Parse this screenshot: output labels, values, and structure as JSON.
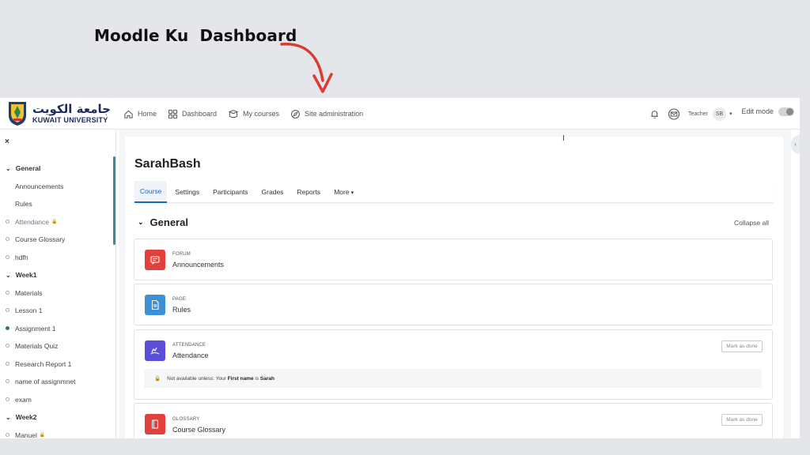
{
  "slide": {
    "title": "Moodle Ku  Dashboard",
    "arrow_color": "#d93a32"
  },
  "logo": {
    "arabic": "جامعة الكويت",
    "english": "KUWAIT UNIVERSITY"
  },
  "nav": {
    "items": [
      {
        "label": "Home",
        "icon": "home-icon"
      },
      {
        "label": "Dashboard",
        "icon": "dashboard-icon"
      },
      {
        "label": "My courses",
        "icon": "courses-icon"
      },
      {
        "label": "Site administration",
        "icon": "site-admin-icon"
      }
    ],
    "role": "Teacher",
    "avatar_initials": "SB",
    "edit_mode_label": "Edit mode"
  },
  "sidebar": {
    "close_label": "×",
    "rows": [
      {
        "kind": "section",
        "label": "General"
      },
      {
        "kind": "item",
        "label": "Announcements"
      },
      {
        "kind": "item",
        "label": "Rules"
      },
      {
        "kind": "item",
        "label": "Attendance",
        "dot": "empty",
        "locked": true,
        "dim": true
      },
      {
        "kind": "item",
        "label": "Course Glossary",
        "dot": "empty"
      },
      {
        "kind": "item",
        "label": "hdfh",
        "dot": "empty"
      },
      {
        "kind": "section",
        "label": "Week1"
      },
      {
        "kind": "item",
        "label": "Materials",
        "dot": "empty"
      },
      {
        "kind": "item",
        "label": "Lesson 1",
        "dot": "empty"
      },
      {
        "kind": "item",
        "label": "Assignment 1",
        "dot": "filled"
      },
      {
        "kind": "item",
        "label": "Materials Quiz",
        "dot": "empty"
      },
      {
        "kind": "item",
        "label": "Research Report 1",
        "dot": "empty"
      },
      {
        "kind": "item",
        "label": "name of assignmnet",
        "dot": "empty"
      },
      {
        "kind": "item",
        "label": "exam",
        "dot": "empty"
      },
      {
        "kind": "section",
        "label": "Week2"
      },
      {
        "kind": "item",
        "label": "Manuel",
        "dot": "empty",
        "locked": true
      }
    ]
  },
  "course": {
    "title": "SarahBash",
    "tabs": [
      "Course",
      "Settings",
      "Participants",
      "Grades",
      "Reports",
      "More"
    ],
    "active_tab": "Course",
    "section_title": "General",
    "collapse_all": "Collapse all"
  },
  "activities": [
    {
      "type": "FORUM",
      "name": "Announcements",
      "icon": "forum-icon",
      "color": "#e2403c"
    },
    {
      "type": "PAGE",
      "name": "Rules",
      "icon": "page-icon",
      "color": "#3d8fd6"
    },
    {
      "type": "ATTENDANCE",
      "name": "Attendance",
      "icon": "attendance-icon",
      "color": "#5b4fd8",
      "mark_done": "Mark as done",
      "restriction": {
        "prefix": "Not available unless: Your ",
        "field": "First name",
        "middle": " is ",
        "value": "Sarah"
      }
    },
    {
      "type": "GLOSSARY",
      "name": "Course Glossary",
      "icon": "glossary-icon",
      "color": "#e2403c",
      "mark_done": "Mark as done"
    }
  ]
}
